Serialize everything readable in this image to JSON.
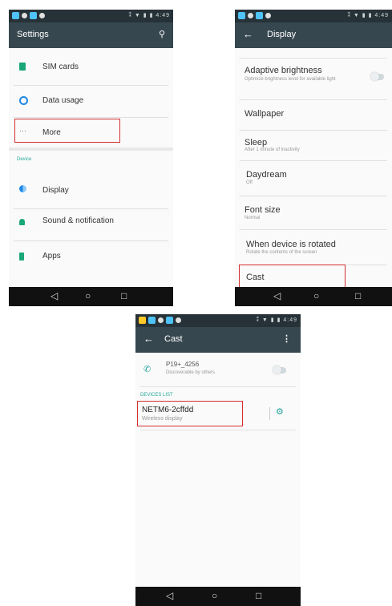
{
  "status_right": "⁑ ▼ ▮ ▮ 4:49",
  "settings": {
    "title": "Settings",
    "items": [
      {
        "label": "SIM cards"
      },
      {
        "label": "Data usage"
      },
      {
        "label": "More"
      }
    ],
    "section": "Device",
    "device_items": [
      {
        "label": "Display"
      },
      {
        "label": "Sound & notification"
      },
      {
        "label": "Apps"
      }
    ]
  },
  "display": {
    "title": "Display",
    "items": [
      {
        "label": "Adaptive brightness",
        "sub": "Optimize brightness level for available light"
      },
      {
        "label": "Wallpaper"
      },
      {
        "label": "Sleep",
        "sub": "After 1 minute of inactivity"
      },
      {
        "label": "Daydream",
        "sub": "Off"
      },
      {
        "label": "Font size",
        "sub": "Normal"
      },
      {
        "label": "When device is rotated",
        "sub": "Rotate the contents of the screen"
      },
      {
        "label": "Cast"
      }
    ]
  },
  "cast": {
    "title": "Cast",
    "device_name": "P19+_4256",
    "device_status": "Discoverable by others",
    "section": "DEVICES LIST",
    "found_device": "NETM6-2cffdd",
    "found_type": "Wireless display"
  }
}
